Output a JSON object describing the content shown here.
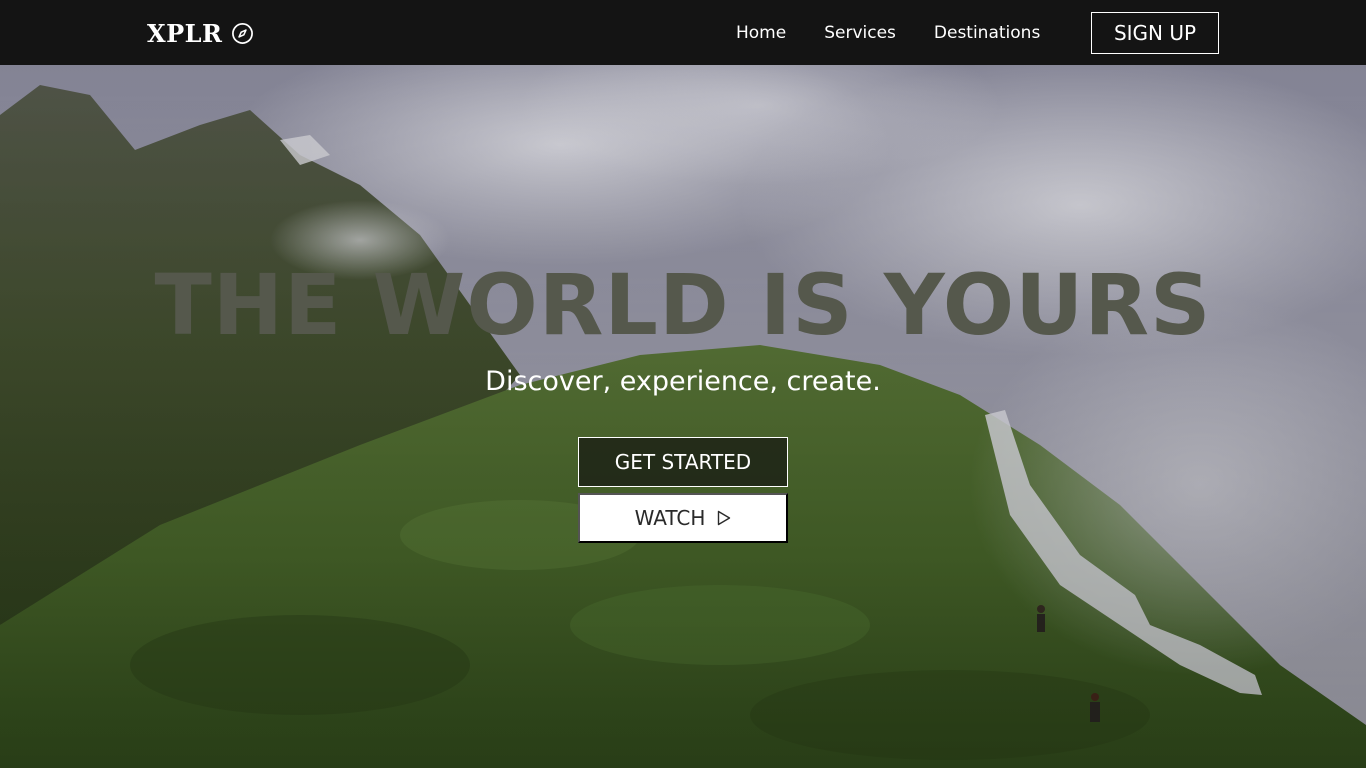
{
  "header": {
    "logo_text": "XPLR",
    "logo_icon": "compass-icon",
    "nav": [
      {
        "label": "Home"
      },
      {
        "label": "Services"
      },
      {
        "label": "Destinations"
      }
    ],
    "signup_label": "SIGN UP"
  },
  "hero": {
    "title": "THE WORLD IS YOURS",
    "subtitle": "Discover, experience, create.",
    "primary_button": "GET STARTED",
    "secondary_button": "WATCH",
    "secondary_icon": "play-icon"
  },
  "colors": {
    "navbar_bg": "#141414",
    "title_text": "#55584c",
    "button_text_light": "#ffffff",
    "watch_button_bg": "#ffffff"
  }
}
